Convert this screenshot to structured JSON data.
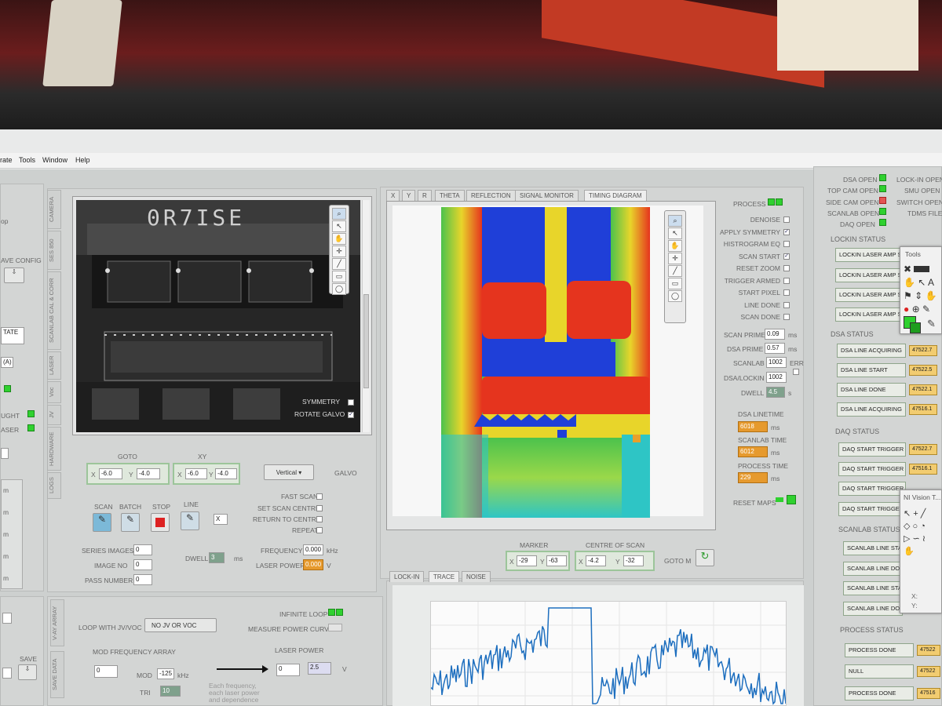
{
  "menubar": {
    "items": [
      "rate",
      "Tools",
      "Window",
      "Help"
    ]
  },
  "left": {
    "labels": [
      "op",
      "AVE CONFIG",
      "TATE",
      "(A)",
      "UGHT",
      "ASER"
    ],
    "tabs": [
      "CAMERA",
      "SES 850",
      "SCANLAB CAL & CORR",
      "LASER",
      "Voc",
      "JV",
      "HARDWARE",
      "LOGS"
    ],
    "bottom_tabs": [
      "V-AY ARRAY",
      "SAVE DATA"
    ],
    "save_label": "SAVE",
    "m_labels": [
      "m",
      "m",
      "m",
      "m",
      "m"
    ]
  },
  "camera": {
    "overlay_text": "0R7ISE",
    "symmetry_label": "SYMMETRY",
    "rotate_label": "ROTATE GALVO",
    "goto_label": "GOTO",
    "goto_x": "-6.0",
    "goto_y": "-4.0",
    "xy_label": "XY",
    "xy_x": "-6.0",
    "xy_y": "-4.0",
    "orientation": "Vertical",
    "galvo_label": "GALVO",
    "scan_label": "SCAN",
    "batch_label": "BATCH",
    "stop_label": "STOP",
    "line_label": "LINE",
    "line_axis": "X",
    "fast_scan": "FAST SCAN",
    "set_centre": "SET SCAN CENTRE",
    "return_centre": "RETURN TO CENTRE",
    "repeat": "REPEAT",
    "series_images": "SERIES IMAGES",
    "series_val": "0",
    "image_no": "IMAGE NO",
    "image_val": "0",
    "pass_number": "PASS NUMBER",
    "pass_val": "0",
    "dwell_label": "DWELL",
    "dwell_val": "3",
    "dwell_unit": "ms",
    "frequency_label": "FREQUENCY",
    "frequency_val": "0.000",
    "frequency_unit": "kHz",
    "laser_power_label": "LASER POWER",
    "laser_power_val": "0.000",
    "laser_power_unit": "V"
  },
  "loop": {
    "loop_label": "LOOP WITH JV/VOC",
    "loop_val": "NO JV OR VOC",
    "infinite_loop": "INFINITE LOOP",
    "measure_power": "MEASURE POWER CURVE",
    "mod_freq": "MOD FREQUENCY ARRAY",
    "mod_val": "0",
    "mod": "MOD",
    "mod_num": "-125",
    "mod_unit": "kHz",
    "tri": "TRI",
    "tri_num": "10",
    "laser_power": "LASER POWER",
    "lp_val": "0",
    "lp_box": "2.5",
    "lp_unit": "V",
    "note": "Each frequency, each laser power and dependence"
  },
  "image_tabs": [
    "X",
    "Y",
    "R",
    "THETA",
    "REFLECTION",
    "SIGNAL MONITOR",
    "TIMING DIAGRAM"
  ],
  "marker": {
    "label": "MARKER",
    "x": "-29",
    "y": "-63"
  },
  "centre": {
    "label": "CENTRE OF SCAN",
    "x": "-4.2",
    "y": "-32",
    "goto_label": "GOTO M"
  },
  "signal_tabs": [
    "LOCK-IN",
    "TRACE",
    "NOISE"
  ],
  "process": {
    "title": "PROCESS",
    "options": [
      {
        "label": "DENOISE",
        "checked": ""
      },
      {
        "label": "APPLY SYMMETRY",
        "checked": "✓"
      },
      {
        "label": "HISTROGRAM EQ",
        "checked": ""
      },
      {
        "label": "SCAN START",
        "checked": "✓"
      },
      {
        "label": "RESET ZOOM",
        "checked": ""
      },
      {
        "label": "TRIGGER ARMED",
        "checked": ""
      },
      {
        "label": "START PIXEL",
        "checked": ""
      },
      {
        "label": "LINE DONE",
        "checked": ""
      },
      {
        "label": "SCAN DONE",
        "checked": ""
      }
    ],
    "scan_prime": "SCAN PRIME",
    "scan_prime_val": "0.09",
    "ms": "ms",
    "dsa_prime": "DSA PRIME",
    "dsa_prime_val": "0.57",
    "scanlab": "SCANLAB",
    "scanlab_val": "1002",
    "err": "ERR",
    "dsa_lockin": "DSA/LOCKIN",
    "dsa_lockin_val": "1002",
    "dwell": "DWELL",
    "dwell_val": "4.5",
    "s": "s",
    "dsa_linetime": "DSA LINETIME",
    "dsa_linetime_val": "6018",
    "scanlab_time": "SCANLAB TIME",
    "scanlab_time_val": "6012",
    "process_time": "PROCESS TIME",
    "process_time_val": "229",
    "reset_maps": "RESET MAPS"
  },
  "devices": {
    "left": [
      "DSA OPEN",
      "TOP CAM OPEN",
      "SIDE CAM OPEN",
      "SCANLAB OPEN",
      "DAQ OPEN"
    ],
    "right": [
      "LOCK-IN OPEN",
      "SMU OPEN",
      "SWITCH OPEN",
      "TDMS FILE"
    ]
  },
  "lockin_status": {
    "title": "LOCKIN STATUS",
    "rows": [
      "LOCKIN LASER AMP SE",
      "LOCKIN LASER AMP SE",
      "LOCKIN LASER AMP SE",
      "LOCKIN LASER AMP SE"
    ]
  },
  "dsa_status": {
    "title": "DSA STATUS",
    "rows": [
      {
        "label": "DSA LINE ACQUIRING",
        "value": "47522.7"
      },
      {
        "label": "DSA LINE START",
        "value": "47522.5"
      },
      {
        "label": "DSA LINE DONE",
        "value": "47522.1"
      },
      {
        "label": "DSA LINE ACQUIRING",
        "value": "47516.1"
      }
    ]
  },
  "daq_status": {
    "title": "DAQ STATUS",
    "rows": [
      {
        "label": "DAQ START TRIGGER",
        "value": "47522.7"
      },
      {
        "label": "DAQ START TRIGGER",
        "value": "47516.1"
      },
      {
        "label": "DAQ START TRIGGER",
        "value": ""
      },
      {
        "label": "DAQ START TRIGGER",
        "value": ""
      }
    ]
  },
  "scanlab_status": {
    "title": "SCANLAB STATUS",
    "rows": [
      "SCANLAB LINE STAR",
      "SCANLAB LINE DON",
      "SCANLAB LINE STAR",
      "SCANLAB LINE DON"
    ]
  },
  "process_status": {
    "title": "PROCESS STATUS",
    "rows": [
      {
        "label": "PROCESS DONE",
        "value": "47522"
      },
      {
        "label": "NULL",
        "value": "47522"
      },
      {
        "label": "PROCESS DONE",
        "value": "47516"
      }
    ]
  },
  "tools_palette": {
    "title": "Tools"
  },
  "vision_palette": {
    "title": "NI Vision T...",
    "x": "X:",
    "y": "Y:"
  },
  "colors": {
    "map_blue": "#1f3fd8",
    "map_red": "#e5341e",
    "map_green": "#4cc24c",
    "map_yellow": "#e8d52a",
    "trace": "#1e6fbf"
  }
}
